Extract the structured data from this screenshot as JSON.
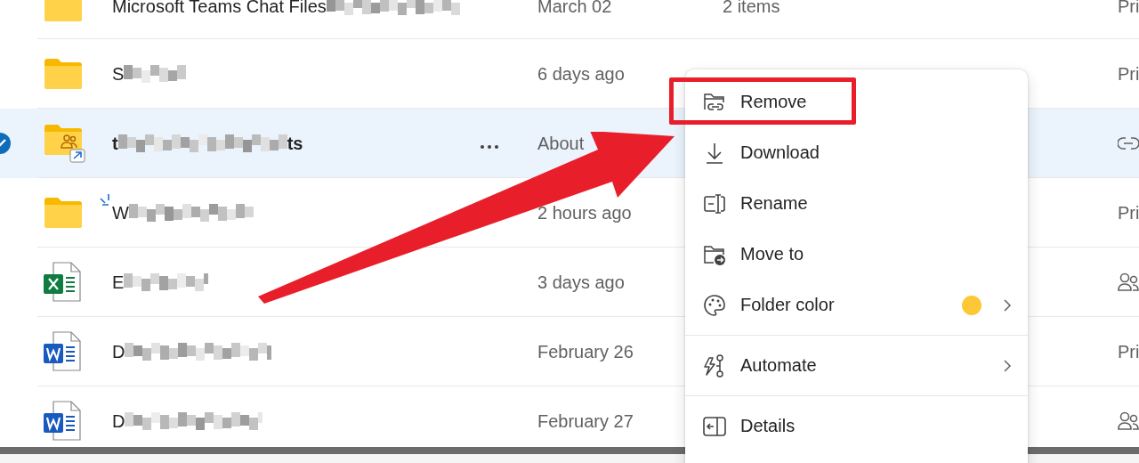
{
  "files": [
    {
      "kind": "folder",
      "name": "Microsoft Teams Chat Files",
      "redacted": true,
      "modified": "March 02",
      "size": "2 items",
      "sharing": {
        "kind": "text",
        "text": "Pri"
      },
      "selected": false,
      "new": false
    },
    {
      "kind": "folder",
      "name": "S",
      "redacted": true,
      "modified": "6 days ago",
      "sharing": {
        "kind": "text",
        "text": "Pri"
      },
      "selected": false,
      "new": false
    },
    {
      "kind": "shared-folder",
      "name": "t",
      "redacted": true,
      "name_end": "ts",
      "modified": "About",
      "sharing": {
        "kind": "link"
      },
      "selected": true,
      "new": false
    },
    {
      "kind": "folder",
      "name": "W",
      "redacted": true,
      "modified": "2 hours ago",
      "sharing": {
        "kind": "text",
        "text": "Pri"
      },
      "selected": false,
      "new": true
    },
    {
      "kind": "excel",
      "name": "E",
      "redacted": true,
      "modified": "3 days ago",
      "sharing": {
        "kind": "people"
      },
      "selected": false,
      "new": false
    },
    {
      "kind": "word",
      "name": "D",
      "redacted": true,
      "modified": "February 26",
      "sharing": {
        "kind": "text",
        "text": "Pri"
      },
      "selected": false,
      "new": false
    },
    {
      "kind": "word",
      "name": "D",
      "redacted": true,
      "modified": "February 27",
      "sharing": {
        "kind": "people"
      },
      "selected": false,
      "new": false
    }
  ],
  "context_menu": {
    "items": [
      {
        "kind": "action",
        "label": "Remove",
        "divider_before": false,
        "highlighted": true
      },
      {
        "kind": "action",
        "label": "Download",
        "divider_before": false,
        "highlighted": false
      },
      {
        "kind": "action",
        "label": "Rename",
        "divider_before": false,
        "highlighted": false
      },
      {
        "kind": "action",
        "label": "Move to",
        "divider_before": false,
        "highlighted": false
      },
      {
        "kind": "submenu",
        "label": "Folder color",
        "color": "#fdc836",
        "divider_before": false,
        "highlighted": false
      },
      {
        "kind": "submenu",
        "label": "Automate",
        "divider_before": true,
        "highlighted": false
      },
      {
        "kind": "action",
        "label": "Details",
        "divider_before": true,
        "highlighted": false
      }
    ]
  }
}
